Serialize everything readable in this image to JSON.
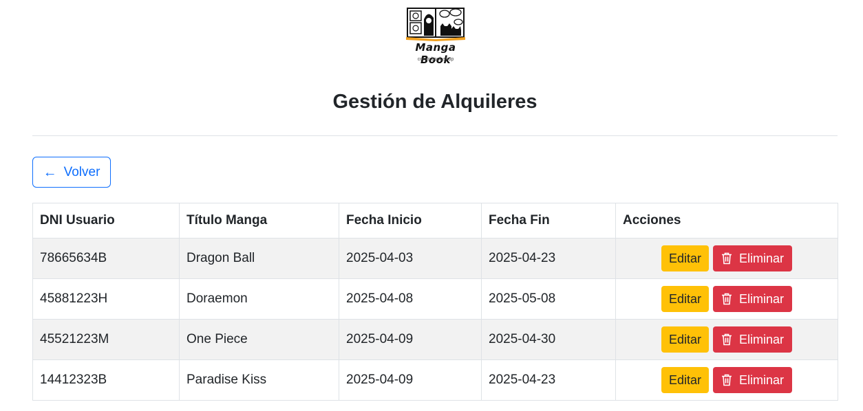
{
  "brand": {
    "name": "Manga Book",
    "tagline": "comic book shop"
  },
  "page": {
    "title": "Gestión de Alquileres"
  },
  "back_button": {
    "label": "Volver",
    "icon": "arrow-left-icon"
  },
  "table": {
    "headers": [
      "DNI Usuario",
      "Título Manga",
      "Fecha Inicio",
      "Fecha Fin",
      "Acciones"
    ],
    "rows": [
      {
        "dni": "78665634B",
        "title": "Dragon Ball",
        "start": "2025-04-03",
        "end": "2025-04-23",
        "edit": "Editar",
        "delete": "Eliminar"
      },
      {
        "dni": "45881223H",
        "title": "Doraemon",
        "start": "2025-04-08",
        "end": "2025-05-08",
        "edit": "Editar",
        "delete": "Eliminar"
      },
      {
        "dni": "45521223M",
        "title": "One Piece",
        "start": "2025-04-09",
        "end": "2025-04-30",
        "edit": "Editar",
        "delete": "Eliminar"
      },
      {
        "dni": "14412323B",
        "title": "Paradise Kiss",
        "start": "2025-04-09",
        "end": "2025-04-23",
        "edit": "Editar",
        "delete": "Eliminar"
      }
    ]
  },
  "colors": {
    "primary": "#0d6efd",
    "warning": "#ffc107",
    "danger": "#dc3545",
    "stripe": "#f2f2f2",
    "text": "#212529"
  }
}
